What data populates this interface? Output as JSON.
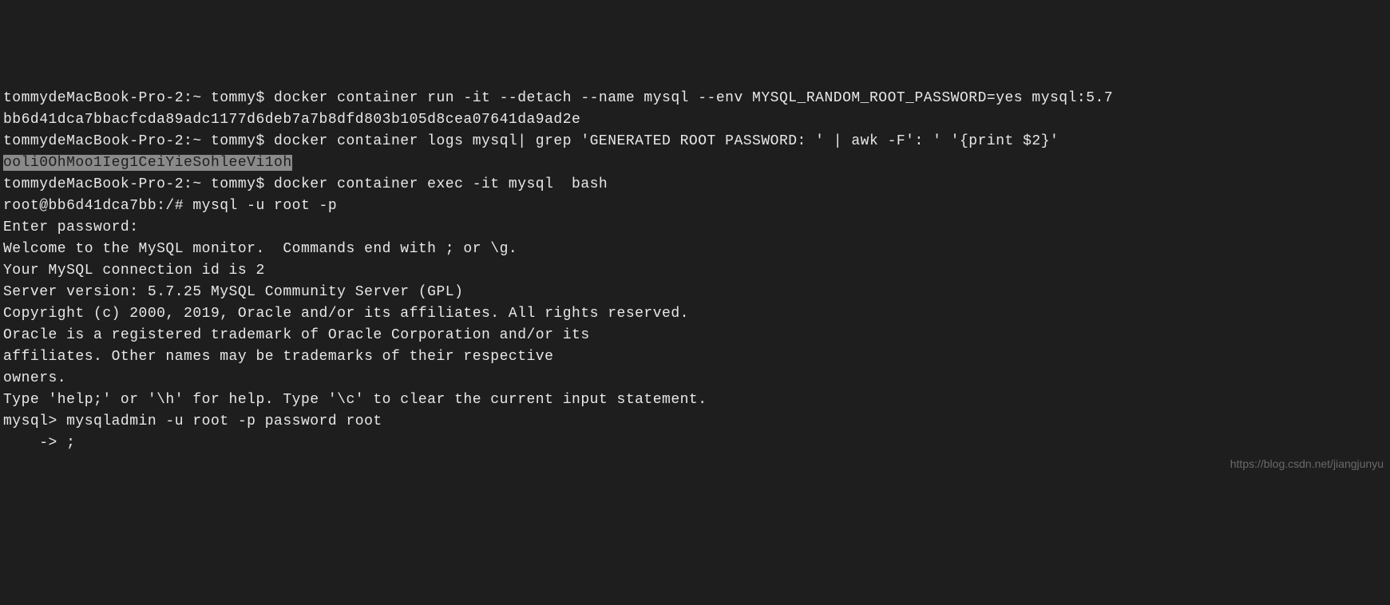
{
  "terminal": {
    "lines": [
      {
        "id": "l1",
        "text": "tommydeMacBook-Pro-2:~ tommy$ docker container run -it --detach --name mysql --env MYSQL_RANDOM_ROOT_PASSWORD=yes mysql:5.7",
        "selected": false
      },
      {
        "id": "l2",
        "text": "bb6d41dca7bbacfcda89adc1177d6deb7a7b8dfd803b105d8cea07641da9ad2e",
        "selected": false
      },
      {
        "id": "l3",
        "text": "tommydeMacBook-Pro-2:~ tommy$ docker container logs mysql| grep 'GENERATED ROOT PASSWORD: ' | awk -F': ' '{print $2}'",
        "selected": false
      },
      {
        "id": "l4",
        "text": "ooli0OhMoo1Ieg1CeiYieSohleeVi1oh",
        "selected": true
      },
      {
        "id": "l5",
        "text": "tommydeMacBook-Pro-2:~ tommy$ docker container exec -it mysql  bash",
        "selected": false
      },
      {
        "id": "l6",
        "text": "root@bb6d41dca7bb:/# mysql -u root -p",
        "selected": false
      },
      {
        "id": "l7",
        "text": "Enter password:",
        "selected": false
      },
      {
        "id": "l8",
        "text": "Welcome to the MySQL monitor.  Commands end with ; or \\g.",
        "selected": false
      },
      {
        "id": "l9",
        "text": "Your MySQL connection id is 2",
        "selected": false
      },
      {
        "id": "l10",
        "text": "Server version: 5.7.25 MySQL Community Server (GPL)",
        "selected": false
      },
      {
        "id": "l11",
        "text": "",
        "selected": false
      },
      {
        "id": "l12",
        "text": "Copyright (c) 2000, 2019, Oracle and/or its affiliates. All rights reserved.",
        "selected": false
      },
      {
        "id": "l13",
        "text": "",
        "selected": false
      },
      {
        "id": "l14",
        "text": "Oracle is a registered trademark of Oracle Corporation and/or its",
        "selected": false
      },
      {
        "id": "l15",
        "text": "affiliates. Other names may be trademarks of their respective",
        "selected": false
      },
      {
        "id": "l16",
        "text": "owners.",
        "selected": false
      },
      {
        "id": "l17",
        "text": "",
        "selected": false
      },
      {
        "id": "l18",
        "text": "Type 'help;' or '\\h' for help. Type '\\c' to clear the current input statement.",
        "selected": false
      },
      {
        "id": "l19",
        "text": "",
        "selected": false
      },
      {
        "id": "l20",
        "text": "mysql> mysqladmin -u root -p password root",
        "selected": false
      },
      {
        "id": "l21",
        "text": "    -> ;",
        "selected": false
      }
    ]
  },
  "watermark": "https://blog.csdn.net/jiangjunyu"
}
